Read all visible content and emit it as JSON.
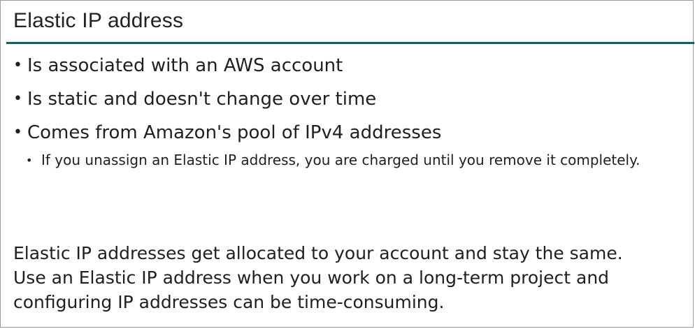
{
  "slide": {
    "title": "Elastic IP address",
    "bullets": [
      {
        "text": "Is associated with an AWS account"
      },
      {
        "text": "Is static and doesn't change over time"
      },
      {
        "text": "Comes from Amazon's pool of IPv4 addresses"
      }
    ],
    "sub_bullet": {
      "text": "If you unassign an Elastic IP address, you are charged until you remove it completely."
    },
    "summary_lines": [
      "Elastic IP addresses get allocated to your account and stay the same.",
      "Use an Elastic IP address when you work on a long-term project and",
      "configuring IP addresses can be time-consuming."
    ],
    "colors": {
      "title_rule": "#1d5a5e",
      "text": "#1f1f1f"
    },
    "icons": {
      "bullet": "bullet-dot-icon"
    }
  }
}
